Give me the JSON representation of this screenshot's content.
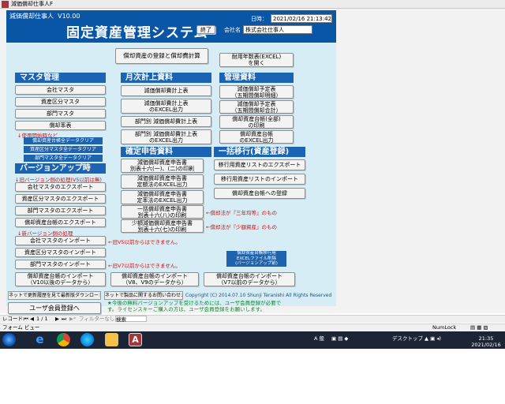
{
  "window": {
    "title": "減価償却仕事人F"
  },
  "header": {
    "app_name": "減価償却仕事人",
    "version": "V10.00",
    "main_title": "固定資産管理システム",
    "exit_label": "終了",
    "date_label": "日時：",
    "date_value": "2021/02/16 21:13:42",
    "company_label": "会社名",
    "company_value": "株式会社仕事人"
  },
  "top_buttons": {
    "register": "償却資産の登録と償却費計算",
    "lifespan": [
      "耐用年数表(EXCEL)",
      "を開く"
    ]
  },
  "master": {
    "heading": "マスタ管理",
    "items": [
      "会社マスタ",
      "資産区分マスタ",
      "部門マスタ",
      "償却率表"
    ],
    "note": "↓使用開始時など",
    "clear_links": [
      "償却資産台帳全データクリア",
      "資産区分マスタ全データクリア",
      "部門マスタ全データクリア"
    ]
  },
  "upgrade": {
    "heading": "バージョンアップ時",
    "note_old": "↓旧バージョン側の処理(V5以前は無)",
    "export_items": [
      "会社マスタのエクスポート",
      "資産区分マスタのエクスポート",
      "部門マスタのエクスポート",
      "償却資産台帳のエクスポート"
    ],
    "note_new": "↓新バージョン側の処理",
    "import_items": [
      "会社マスタのインポート",
      "資産区分マスタのインポート",
      "部門マスタのインポート"
    ],
    "note_v5": "←旧V5以前からはできません。",
    "note_v7": "←旧V7以前からはできません。"
  },
  "monthly": {
    "heading": "月次計上資料",
    "items": [
      [
        "減価償却費計上表"
      ],
      [
        "減価償却費計上表",
        "のEXCEL出力"
      ],
      [
        "部門別 減価償却費計上表"
      ],
      [
        "部門別 減価償却費計上表",
        "のEXCEL出力"
      ]
    ]
  },
  "management": {
    "heading": "管理資料",
    "items": [
      [
        "減価償却予定表",
        "（五期間償却明細）"
      ],
      [
        "減価償却予定表",
        "（五期間償却合計）"
      ],
      [
        "償却資産台帳(全部)",
        "の印刷"
      ],
      [
        "償却資産台帳",
        "のEXCEL出力"
      ]
    ]
  },
  "tax_return": {
    "heading": "確定申告資料",
    "items": [
      [
        "減価償却資産申告書",
        "別表十六(一)、(二)の印刷"
      ],
      [
        "減価償却資産申告書",
        "定額法のEXCEL出力"
      ],
      [
        "減価償却資産申告書",
        "定率法のEXCEL出力"
      ],
      [
        "一括償却資産申告書",
        "別表十六(八)の印刷"
      ],
      [
        "少額減価償却資産申告書",
        "別表十六(七)の印刷"
      ]
    ],
    "note_3years": "←償却法が『三年均等』のもの",
    "note_small": "←償却法が『少額資産』のもの"
  },
  "migration": {
    "heading": "一括移行(資産登録)",
    "items": [
      "移行用資産リストのエクスポート",
      "移行用資産リストのインポート",
      "償却資産台帳への登録"
    ],
    "delete_link": [
      "償却資産台帳移行用",
      "EXCELファイル削除",
      "(バージョンアップ前)"
    ]
  },
  "bottom_imports": [
    [
      "償却資産台帳のインポート",
      "（V10以後のデータから）"
    ],
    [
      "償却資産台帳のインポート",
      "（V8、V9のデータから）"
    ],
    [
      "償却資産台帳のインポート",
      "（V7以前のデータから）"
    ]
  ],
  "footer": {
    "download_btn": "ネットで更新履歴を見て最新版ダウンロード",
    "inquiry_btn": "ネットで製品に関するお問い合わせメール",
    "copyright": "Copyright (C) 2014.07.10 Shunji Teranishi All Rights Reserved",
    "register_btn": "ユーザ会員登録へ",
    "notice": "★今後の無料バージョンアップを受けるためには、ユーザ会員登録が必要です。ライセンスキーご購入の方は、ユーザ会員登録をお願いします。"
  },
  "navbar": {
    "record_label": "レコード:",
    "record_value": "1 / 1",
    "filter": "フィルターなし",
    "search": "検索"
  },
  "statusbar": {
    "left": "フォーム ビュー",
    "right": "NumLock"
  },
  "taskbar": {
    "ime": "A 般",
    "desktop": "デスクトップ",
    "time": "21:35",
    "date": "2021/02/16",
    "colors": {
      "background": "#1c2536",
      "access": "#a4373a",
      "header": "#0a56a6"
    }
  }
}
